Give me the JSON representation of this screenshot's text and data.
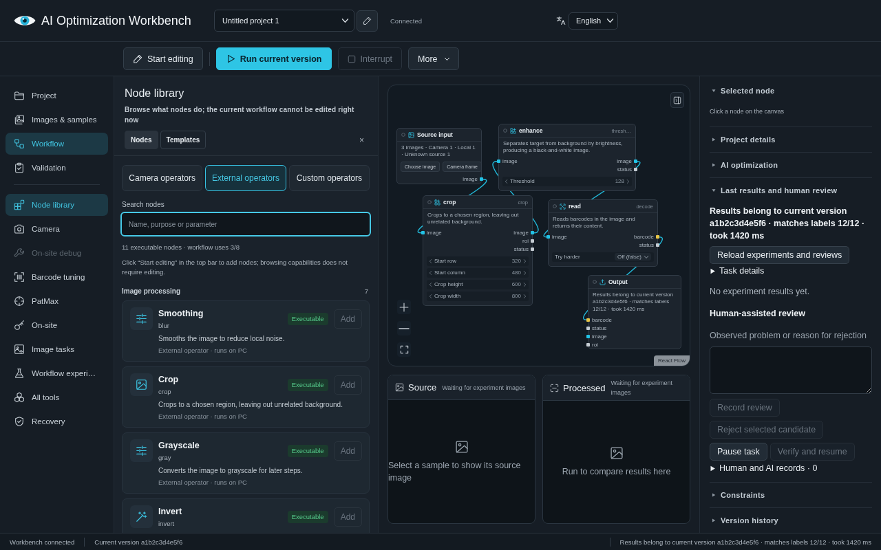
{
  "header": {
    "title": "AI Optimization Workbench",
    "project_select": {
      "value": "Untitled project 1"
    },
    "connection_status": "Connected",
    "language_select": {
      "value": "English"
    }
  },
  "toolbar": {
    "buttons": [
      {
        "kind": "edit",
        "label": "Start editing",
        "disabled": false
      },
      {
        "kind": "primary",
        "label": "Run current version",
        "disabled": false
      },
      {
        "kind": "stop",
        "label": "Interrupt",
        "disabled": true
      },
      {
        "kind": "menu",
        "label": "More",
        "disabled": false
      }
    ]
  },
  "sidebar": {
    "sections": [
      {
        "items": [
          {
            "label": "Project",
            "selected": false,
            "disabled": false
          },
          {
            "label": "Images & samples",
            "selected": false,
            "disabled": false
          },
          {
            "label": "Workflow",
            "selected": true,
            "disabled": false
          },
          {
            "label": "Validation",
            "selected": false,
            "disabled": false
          }
        ]
      },
      {
        "items": [
          {
            "label": "Node library",
            "selected": true,
            "disabled": false
          },
          {
            "label": "Camera",
            "selected": false,
            "disabled": false
          },
          {
            "label": "On-site debug",
            "selected": false,
            "disabled": true
          },
          {
            "label": "Barcode tuning",
            "selected": false,
            "disabled": false
          },
          {
            "label": "PatMax",
            "selected": false,
            "disabled": false
          },
          {
            "label": "On-site",
            "selected": false,
            "disabled": false
          },
          {
            "label": "Image tasks",
            "selected": false,
            "disabled": false
          },
          {
            "label": "Workflow experi…",
            "selected": false,
            "disabled": false
          },
          {
            "label": "All tools",
            "selected": false,
            "disabled": false
          },
          {
            "label": "Recovery",
            "selected": false,
            "disabled": false
          }
        ]
      }
    ]
  },
  "node_library": {
    "title": "Node library",
    "description": "Browse what nodes do; the current workflow cannot be edited right now",
    "tabs": [
      {
        "label": "Nodes",
        "selected": true
      },
      {
        "label": "Templates",
        "selected": false
      }
    ],
    "close_label": "×",
    "categories": [
      {
        "label": "Camera operators",
        "selected": false
      },
      {
        "label": "External operators",
        "selected": true
      },
      {
        "label": "Custom operators",
        "selected": false
      }
    ],
    "search": {
      "label": "Search nodes",
      "placeholder": "Name, purpose or parameter",
      "focused": true
    },
    "summary": "11 executable nodes · workflow uses 3/8",
    "hint": "Click “Start editing” in the top bar to add nodes; browsing capabilities does not require editing.",
    "groups": [
      {
        "title": "Image processing",
        "count": "7",
        "nodes": [
          {
            "name": "Smoothing",
            "code": "blur",
            "description": "Smooths the image to reduce local noise.",
            "meta": "External operator · runs on PC",
            "status": "Executable",
            "add": {
              "label": "Add",
              "disabled": true
            }
          },
          {
            "name": "Crop",
            "code": "crop",
            "description": "Crops to a chosen region, leaving out unrelated background.",
            "meta": "External operator · runs on PC",
            "status": "Executable",
            "add": {
              "label": "Add",
              "disabled": true
            }
          },
          {
            "name": "Grayscale",
            "code": "gray",
            "description": "Converts the image to grayscale for later steps.",
            "meta": "External operator · runs on PC",
            "status": "Executable",
            "add": {
              "label": "Add",
              "disabled": true
            }
          },
          {
            "name": "Invert",
            "code": "invert",
            "status": "Executable",
            "add": {
              "label": "Add",
              "disabled": true
            }
          }
        ]
      }
    ]
  },
  "canvas": {
    "nodes": [
      {
        "title": "Source input",
        "description": "3 images · Camera 1 · Local 1 · Unknown source 1",
        "buttons": [
          "Choose image",
          "Camera frame"
        ],
        "outputs": [
          {
            "label": "image",
            "color": "#22c3e6"
          }
        ]
      },
      {
        "title": "enhance",
        "tag": "thresh…",
        "description": "Separates target from background by brightness, producing a black-and-white image.",
        "inputs": [
          {
            "label": "image",
            "color": "#22c3e6"
          }
        ],
        "outputs": [
          {
            "label": "image",
            "color": "#22c3e6"
          },
          {
            "label": "status",
            "color": "#c5ccd3"
          }
        ],
        "params": [
          {
            "kind": "stepper",
            "label": "Threshold",
            "value": "128"
          }
        ]
      },
      {
        "title": "crop",
        "tag": "crop",
        "description": "Crops to a chosen region, leaving out unrelated background.",
        "inputs": [
          {
            "label": "image",
            "color": "#22c3e6"
          }
        ],
        "outputs": [
          {
            "label": "image",
            "color": "#22c3e6"
          },
          {
            "label": "roi",
            "color": "#c5ccd3"
          },
          {
            "label": "status",
            "color": "#c5ccd3"
          }
        ],
        "params": [
          {
            "kind": "stepper",
            "label": "Start row",
            "value": "320"
          },
          {
            "kind": "stepper",
            "label": "Start column",
            "value": "480"
          },
          {
            "kind": "stepper",
            "label": "Crop height",
            "value": "600"
          },
          {
            "kind": "stepper",
            "label": "Crop width",
            "value": "800"
          }
        ]
      },
      {
        "title": "read",
        "tag": "decode",
        "description": "Reads barcodes in the image and returns their content.",
        "inputs": [
          {
            "label": "image",
            "color": "#22c3e6"
          }
        ],
        "outputs": [
          {
            "label": "barcode",
            "color": "#e8c547"
          },
          {
            "label": "status",
            "color": "#c5ccd3"
          }
        ],
        "params": [
          {
            "kind": "select",
            "label": "Try harder",
            "value": "Off (false)"
          }
        ]
      },
      {
        "title": "Output",
        "description": "Results belong to current version a1b2c3d4e5f6 · matches labels 12/12 · took 1420 ms",
        "inputs": [
          {
            "label": "barcode",
            "color": "#e8c547"
          },
          {
            "label": "status",
            "color": "#c5ccd3"
          },
          {
            "label": "image",
            "color": "#22c3e6"
          },
          {
            "label": "roi",
            "color": "#c5ccd3"
          }
        ]
      }
    ],
    "attribution": "React Flow"
  },
  "previews": [
    {
      "title": "Source",
      "status": "Waiting for experiment images",
      "empty_text": "Select a sample to show its source image"
    },
    {
      "title": "Processed",
      "status": "Waiting for experiment images",
      "empty_text": "Run to compare results here"
    }
  ],
  "inspector": {
    "sections": [
      {
        "title": "Selected node",
        "expanded": true,
        "hint": "Click a node on the canvas"
      },
      {
        "title": "Project details",
        "expanded": false
      },
      {
        "title": "AI optimization",
        "expanded": false
      },
      {
        "title": "Last results and human review",
        "expanded": true,
        "summary": "Results belong to current version a1b2c3d4e5f6 · matches labels 12/12 · took 1420 ms",
        "reload_button": "Reload experiments and reviews",
        "task_details": {
          "label": "Task details",
          "expanded": false
        },
        "empty_text": "No experiment results yet.",
        "review": {
          "title": "Human-assisted review",
          "field_label": "Observed problem or reason for rejection",
          "buttons": [
            {
              "label": "Record review",
              "disabled": true
            },
            {
              "label": "Reject selected candidate",
              "disabled": true
            },
            {
              "label": "Pause task",
              "disabled": false
            },
            {
              "label": "Verify and resume",
              "disabled": true
            }
          ],
          "records": {
            "label": "Human and AI records · 0",
            "expanded": false
          }
        }
      },
      {
        "title": "Constraints",
        "expanded": false
      },
      {
        "title": "Version history",
        "expanded": false
      }
    ]
  },
  "status_bar": {
    "left": [
      "Workbench connected",
      "Current version a1b2c3d4e5f6"
    ],
    "right": "Results belong to current version a1b2c3d4e5f6 · matches labels 12/12 · took 1420 ms"
  }
}
